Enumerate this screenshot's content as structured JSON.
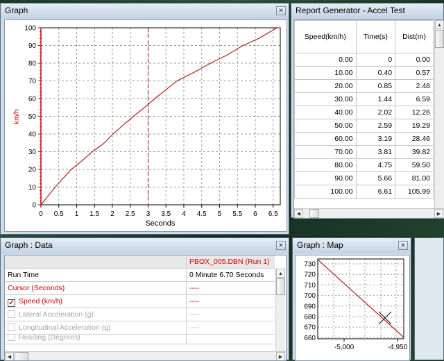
{
  "graph_window": {
    "title": "Graph",
    "close_glyph": "✕",
    "y_axis_label": "km/h",
    "x_axis_label": "Seconds",
    "y_ticks": [
      "0",
      "10",
      "20",
      "30",
      "40",
      "50",
      "60",
      "70",
      "80",
      "90",
      "100"
    ],
    "x_ticks": [
      "0",
      "0.5",
      "1",
      "1.5",
      "2",
      "2.5",
      "3",
      "3.5",
      "4",
      "4.5",
      "5",
      "5.5",
      "6",
      "6.5"
    ]
  },
  "chart_data": {
    "type": "line",
    "xlabel": "Seconds",
    "ylabel": "km/h",
    "xlim": [
      0,
      6.7
    ],
    "ylim": [
      0,
      100
    ],
    "grid": true,
    "cursor_x": 3.0,
    "series": [
      {
        "color": "#b22222",
        "x": [
          0,
          0.2,
          0.4,
          0.6,
          0.85,
          1.1,
          1.44,
          1.75,
          2.02,
          2.3,
          2.59,
          2.9,
          3.19,
          3.5,
          3.81,
          4.3,
          4.75,
          5.2,
          5.66,
          6.1,
          6.61,
          6.7
        ],
        "y": [
          0,
          5,
          10,
          14.5,
          20,
          24,
          30,
          34.5,
          40,
          45,
          50,
          55,
          60,
          65,
          70,
          75,
          80,
          84.5,
          90,
          94,
          100,
          100
        ]
      }
    ]
  },
  "report_window": {
    "title": "Report Generator - Accel Test",
    "headers": [
      "Speed(km/h)",
      "Time(s)",
      "Dist(m)"
    ],
    "rows": [
      [
        "0.00",
        "0",
        "0.00"
      ],
      [
        "10.00",
        "0.40",
        "0.57"
      ],
      [
        "20.00",
        "0.85",
        "2.48"
      ],
      [
        "30.00",
        "1.44",
        "6.59"
      ],
      [
        "40.00",
        "2.02",
        "12.26"
      ],
      [
        "50.00",
        "2.59",
        "19.29"
      ],
      [
        "60.00",
        "3.19",
        "28.46"
      ],
      [
        "70.00",
        "3.81",
        "39.82"
      ],
      [
        "80.00",
        "4.75",
        "59.50"
      ],
      [
        "90.00",
        "5.66",
        "81.00"
      ],
      [
        "100.00",
        "6.61",
        "105.99"
      ]
    ]
  },
  "data_window": {
    "title": "Graph : Data",
    "close_glyph": "✕",
    "file_header": "PBOX_005.DBN (Run 1)",
    "rows": [
      {
        "label": "Run Time",
        "value": "0 Minute 6.70 Seconds"
      },
      {
        "label": "Cursor (Seconds)",
        "value": "----"
      },
      {
        "label": "Speed (km/h)",
        "value": "----"
      },
      {
        "label": "Lateral Acceleration (g)",
        "value": "----"
      },
      {
        "label": "Longitudinal Acceleration (g)",
        "value": "----"
      },
      {
        "label": "Heading (Degrees)",
        "value": ""
      }
    ]
  },
  "map_window": {
    "title": "Graph : Map",
    "close_glyph": "✕",
    "y_ticks": [
      "730",
      "720",
      "710",
      "700",
      "690",
      "680",
      "670",
      "660"
    ],
    "x_ticks": [
      "-5,000",
      "-4,950"
    ]
  },
  "colors": {
    "trace": "#b22222",
    "axis_red": "#cc0000",
    "window_frame": "#cfdbe8"
  }
}
